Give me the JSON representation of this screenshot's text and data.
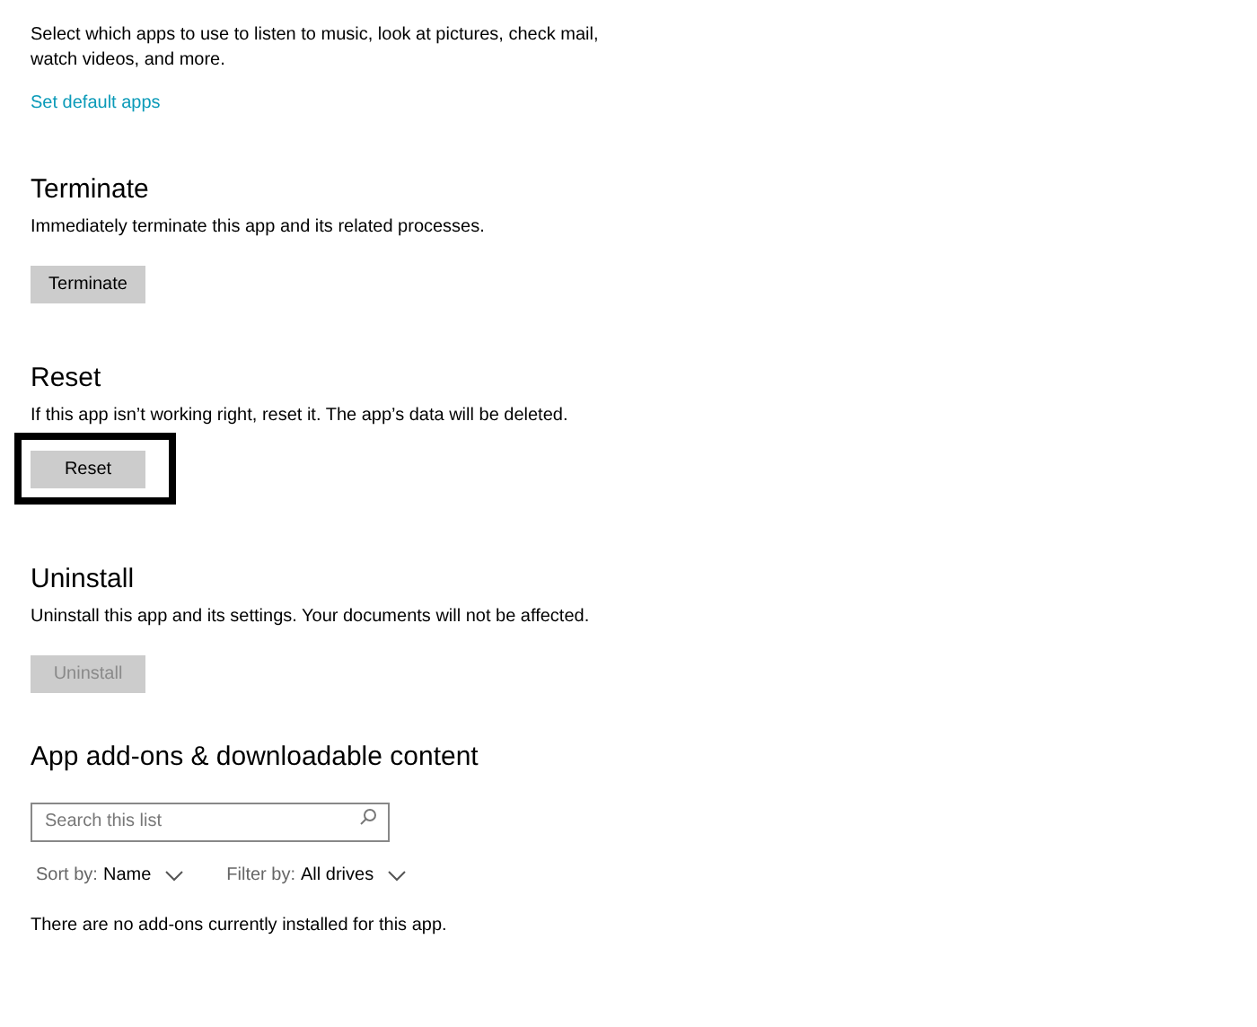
{
  "sections": [
    {
      "description": "Select which apps to use to listen to music, look at pictures, check mail, watch videos, and more.",
      "link": "Set default apps"
    },
    {
      "heading": "Terminate",
      "description": "Immediately terminate this app and its related processes.",
      "button": {
        "label": "Terminate",
        "disabled": false,
        "highlighted": false
      }
    },
    {
      "heading": "Reset",
      "description": "If this app isn’t working right, reset it. The app’s data will be deleted.",
      "button": {
        "label": "Reset",
        "disabled": false,
        "highlighted": true
      }
    },
    {
      "heading": "Uninstall",
      "description": "Uninstall this app and its settings. Your documents will not be affected.",
      "button": {
        "label": "Uninstall",
        "disabled": true,
        "highlighted": false
      }
    }
  ],
  "addons": {
    "heading": "App add-ons & downloadable content",
    "search": {
      "placeholder": "Search this list"
    },
    "filters": [
      {
        "label": "Sort by:",
        "value": "Name"
      },
      {
        "label": "Filter by:",
        "value": "All drives"
      }
    ],
    "empty_message": "There are no add-ons currently installed for this app."
  }
}
